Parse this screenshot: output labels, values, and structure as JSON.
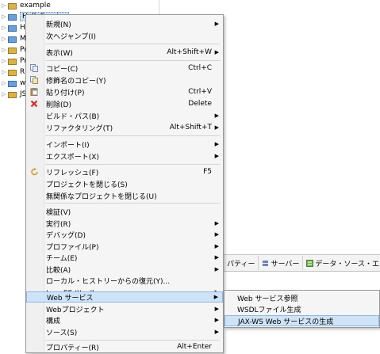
{
  "tree": {
    "items": [
      {
        "label": "example",
        "icon": "project-folder-icon"
      },
      {
        "label": "HelloService",
        "icon": "web-project-icon",
        "selected": true
      },
      {
        "label": "He",
        "icon": "web-project-icon"
      },
      {
        "label": "MI",
        "icon": "web-project-icon"
      },
      {
        "label": "Pro",
        "icon": "project-folder-icon"
      },
      {
        "label": "Pro",
        "icon": "project-folder-icon"
      },
      {
        "label": "RP",
        "icon": "project-folder-icon"
      },
      {
        "label": "ws",
        "icon": "web-project-icon"
      },
      {
        "label": "JSF",
        "icon": "project-folder-icon"
      }
    ]
  },
  "tabs": [
    {
      "label": "パティー",
      "icon": "properties-icon"
    },
    {
      "label": "サーバー",
      "icon": "servers-icon"
    },
    {
      "label": "データ・ソース・エクスプ",
      "icon": "data-source-icon"
    }
  ],
  "menu": {
    "items": [
      {
        "label": "新規(N)",
        "shortcut": "",
        "submenu": true,
        "icon": ""
      },
      {
        "label": "次へジャンプ(I)",
        "shortcut": "",
        "submenu": false,
        "icon": ""
      },
      {
        "label": "表示(W)",
        "shortcut": "Alt+Shift+W",
        "submenu": true,
        "icon": ""
      },
      {
        "label": "コピー(C)",
        "shortcut": "Ctrl+C",
        "submenu": false,
        "icon": "copy-icon"
      },
      {
        "label": "修飾名のコピー(Y)",
        "shortcut": "",
        "submenu": false,
        "icon": "copy-qualified-icon"
      },
      {
        "label": "貼り付け(P)",
        "shortcut": "Ctrl+V",
        "submenu": false,
        "icon": "paste-icon"
      },
      {
        "label": "削除(D)",
        "shortcut": "Delete",
        "submenu": false,
        "icon": "delete-icon"
      },
      {
        "label": "ビルド・パス(B)",
        "shortcut": "",
        "submenu": true,
        "icon": ""
      },
      {
        "label": "リファクタリング(T)",
        "shortcut": "Alt+Shift+T",
        "submenu": true,
        "icon": ""
      },
      {
        "label": "インポート(I)",
        "shortcut": "",
        "submenu": true,
        "icon": ""
      },
      {
        "label": "エクスポート(X)",
        "shortcut": "",
        "submenu": true,
        "icon": ""
      },
      {
        "label": "リフレッシュ(F)",
        "shortcut": "F5",
        "submenu": false,
        "icon": "refresh-icon"
      },
      {
        "label": "プロジェクトを閉じる(S)",
        "shortcut": "",
        "submenu": false,
        "icon": ""
      },
      {
        "label": "無関係なプロジェクトを閉じる(U)",
        "shortcut": "",
        "submenu": false,
        "icon": ""
      },
      {
        "label": "検証(V)",
        "shortcut": "",
        "submenu": false,
        "icon": ""
      },
      {
        "label": "実行(R)",
        "shortcut": "",
        "submenu": true,
        "icon": ""
      },
      {
        "label": "デバッグ(D)",
        "shortcut": "",
        "submenu": true,
        "icon": ""
      },
      {
        "label": "プロファイル(P)",
        "shortcut": "",
        "submenu": true,
        "icon": ""
      },
      {
        "label": "チーム(E)",
        "shortcut": "",
        "submenu": true,
        "icon": ""
      },
      {
        "label": "比較(A)",
        "shortcut": "",
        "submenu": true,
        "icon": ""
      },
      {
        "label": "ローカル・ヒストリーからの復元(Y)...",
        "shortcut": "",
        "submenu": false,
        "icon": ""
      },
      {
        "label": "Java EE ツール",
        "shortcut": "",
        "submenu": true,
        "icon": ""
      },
      {
        "label": "Web サービス",
        "shortcut": "",
        "submenu": true,
        "icon": "",
        "active": true
      },
      {
        "label": "Webプロジェクト",
        "shortcut": "",
        "submenu": true,
        "icon": ""
      },
      {
        "label": "構成",
        "shortcut": "",
        "submenu": true,
        "icon": ""
      },
      {
        "label": "ソース(S)",
        "shortcut": "",
        "submenu": true,
        "icon": ""
      },
      {
        "label": "プロパティー(R)",
        "shortcut": "Alt+Enter",
        "submenu": false,
        "icon": ""
      }
    ]
  },
  "submenu": {
    "items": [
      {
        "label": "Web サービス参照"
      },
      {
        "label": "WSDLファイル生成"
      },
      {
        "label": "JAX-WS Web サービスの生成",
        "hover": true
      }
    ]
  },
  "colors": {
    "menu_bg": "#f5f5f5",
    "highlight_bg": "#cfe3f8",
    "highlight_border": "#8fb6e0",
    "delete_red": "#d22b2b"
  }
}
